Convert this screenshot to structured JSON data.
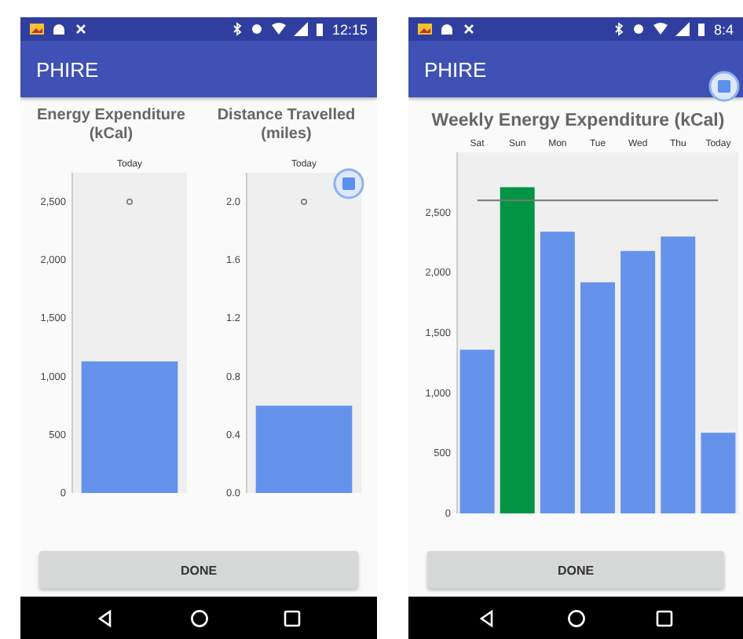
{
  "phones": [
    {
      "status_bar": {
        "time": "12:15"
      },
      "app_bar": {
        "title": "PHIRE"
      },
      "button": "DONE",
      "charts": [
        {
          "title": "Energy Expenditure (kCal)",
          "chart_data": {
            "type": "bar",
            "categories": [
              "Today"
            ],
            "ylim": [
              0,
              2750
            ],
            "yticks": [
              {
                "value": 0,
                "label": "0"
              },
              {
                "value": 500,
                "label": "500"
              },
              {
                "value": 1000,
                "label": "1,000"
              },
              {
                "value": 1500,
                "label": "1,500"
              },
              {
                "value": 2000,
                "label": "2,000"
              },
              {
                "value": 2500,
                "label": "2,500"
              }
            ],
            "series": [
              {
                "color": "#6593eb",
                "values": [
                  1130
                ]
              },
              {
                "type": "scatter",
                "color": "#777777",
                "values": [
                  2500
                ]
              }
            ]
          }
        },
        {
          "title": "Distance Travelled (miles)",
          "chart_data": {
            "type": "bar",
            "categories": [
              "Today"
            ],
            "ylim": [
              0,
              2.2
            ],
            "yticks": [
              {
                "value": 0,
                "label": "0.0"
              },
              {
                "value": 0.4,
                "label": "0.4"
              },
              {
                "value": 0.8,
                "label": "0.8"
              },
              {
                "value": 1.2,
                "label": "1.2"
              },
              {
                "value": 1.6,
                "label": "1.6"
              },
              {
                "value": 2,
                "label": "2.0"
              }
            ],
            "series": [
              {
                "color": "#6593eb",
                "values": [
                  0.6
                ]
              },
              {
                "type": "scatter",
                "color": "#777777",
                "values": [
                  2
                ]
              }
            ]
          }
        }
      ]
    },
    {
      "status_bar": {
        "time": "8:4"
      },
      "app_bar": {
        "title": "PHIRE"
      },
      "button": "DONE",
      "charts": [
        {
          "title": "Weekly Energy Expenditure (kCal)",
          "chart_data": {
            "type": "bar",
            "stacked": true,
            "categories": [
              "Sat",
              "Sun",
              "Mon",
              "Tue",
              "Wed",
              "Thu",
              "Today"
            ],
            "ylim": [
              0,
              3000
            ],
            "yticks": [
              {
                "value": 0,
                "label": "0"
              },
              {
                "value": 500,
                "label": "500"
              },
              {
                "value": 1000,
                "label": "1,000"
              },
              {
                "value": 1500,
                "label": "1,500"
              },
              {
                "value": 2000,
                "label": "2,000"
              },
              {
                "value": 2500,
                "label": "2,500"
              }
            ],
            "series": [
              {
                "color": "#6593eb",
                "values": [
                  1360,
                  null,
                  2340,
                  1920,
                  2180,
                  2300,
                  670
                ]
              },
              {
                "color": "#009444",
                "values": [
                  null,
                  2710,
                  null,
                  null,
                  null,
                  null,
                  null
                ]
              },
              {
                "type": "line",
                "color": "#777777",
                "values": [
                  2600,
                  2600,
                  2600,
                  2600,
                  2600,
                  2600,
                  2600
                ]
              }
            ]
          }
        }
      ]
    }
  ]
}
